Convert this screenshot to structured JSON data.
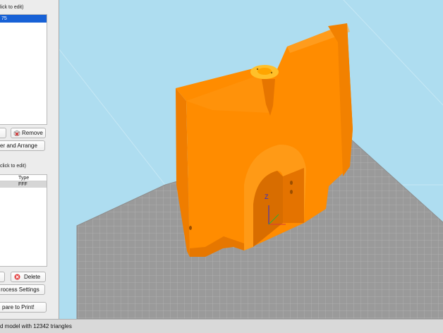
{
  "objects_panel": {
    "title": "lick to edit)",
    "selected_item": "75",
    "remove_label": "Remove",
    "arrange_label": "er and Arrange"
  },
  "settings_panel": {
    "title": "click to edit)",
    "type_header": "Type",
    "row_type": "FFF",
    "delete_label": "Delete",
    "process_label": "rocess Settings",
    "prepare_label": "pare to Print!"
  },
  "viewport": {
    "background": "#aeddf0",
    "model_color": "#ff8c00",
    "bed_color": "#9a9a9a",
    "z_axis_label": "Z"
  },
  "status": {
    "text": "d model with 12342 triangles"
  },
  "icons": [
    "delete-cube-icon",
    "delete-icon",
    "axis-gizmo-icon"
  ]
}
